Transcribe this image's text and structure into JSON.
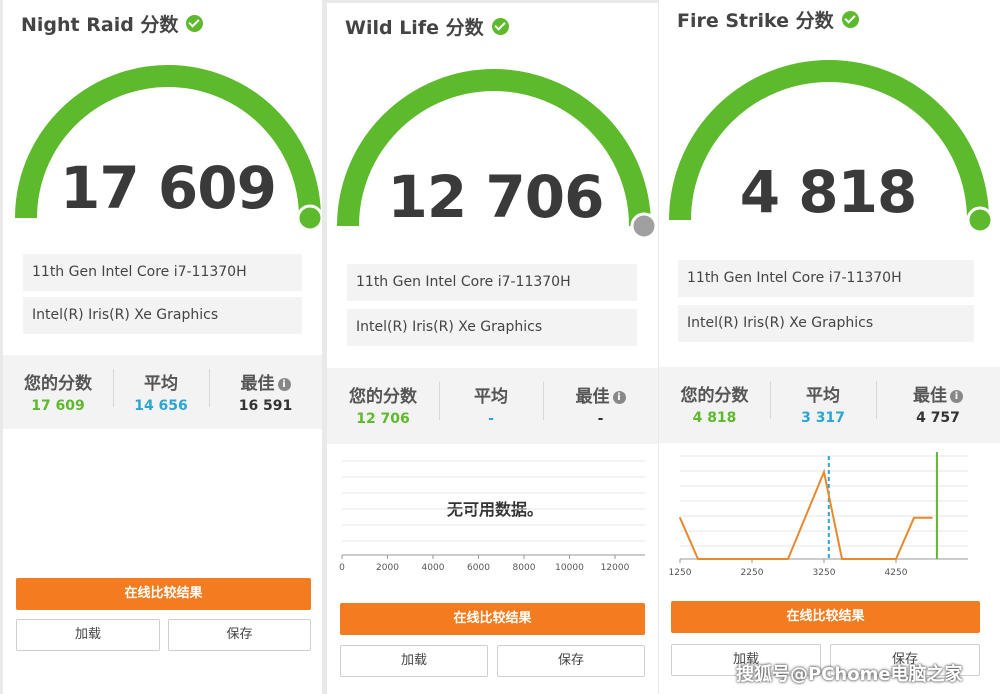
{
  "panels": [
    {
      "title": "Night Raid 分数",
      "score": "17 609",
      "cpu": "11th Gen Intel Core i7-11370H",
      "gpu": "Intel(R) Iris(R) Xe Graphics",
      "stats": {
        "yours_label": "您的分数",
        "yours_value": "17 609",
        "avg_label": "平均",
        "avg_value": "14 656",
        "best_label": "最佳",
        "best_value": "16 591"
      },
      "compare_label": "在线比较结果",
      "load_label": "加载",
      "save_label": "保存",
      "gauge_color": "#5cba2c",
      "gauge_dot_color": "#5cba2c"
    },
    {
      "title": "Wild Life 分数",
      "score": "12 706",
      "cpu": "11th Gen Intel Core i7-11370H",
      "gpu": "Intel(R) Iris(R) Xe Graphics",
      "stats": {
        "yours_label": "您的分数",
        "yours_value": "12 706",
        "avg_label": "平均",
        "avg_value": "-",
        "best_label": "最佳",
        "best_value": "-"
      },
      "chart": {
        "no_data": "无可用数据。",
        "ticks": [
          "0",
          "2000",
          "4000",
          "6000",
          "8000",
          "10000",
          "12000"
        ]
      },
      "compare_label": "在线比较结果",
      "load_label": "加载",
      "save_label": "保存",
      "gauge_color": "#5cba2c",
      "gauge_dot_color": "#a0a0a0"
    },
    {
      "title": "Fire Strike 分数",
      "score": "4 818",
      "cpu": "11th Gen Intel Core i7-11370H",
      "gpu": "Intel(R) Iris(R) Xe Graphics",
      "stats": {
        "yours_label": "您的分数",
        "yours_value": "4 818",
        "avg_label": "平均",
        "avg_value": "3 317",
        "best_label": "最佳",
        "best_value": "4 757"
      },
      "chart": {
        "ticks": [
          "1250",
          "2250",
          "3250",
          "4250"
        ]
      },
      "compare_label": "在线比较结果",
      "load_label": "加载",
      "save_label": "保存",
      "gauge_color": "#5cba2c",
      "gauge_dot_color": "#5cba2c"
    }
  ],
  "chart_data": {
    "type": "line",
    "x": [
      1250,
      1500,
      2750,
      3250,
      3500,
      4250,
      4500,
      4750
    ],
    "series": [
      {
        "values": [
          18,
          0,
          0,
          38,
          0,
          0,
          18,
          18
        ]
      }
    ],
    "xlim": [
      1250,
      5250
    ],
    "average": 3317,
    "best": 4757,
    "score": 4818,
    "line_color": "#e8892c",
    "avg_color": "#2aa6d6",
    "score_color": "#5cba2c"
  },
  "watermark": "搜狐号@PChome电脑之家"
}
